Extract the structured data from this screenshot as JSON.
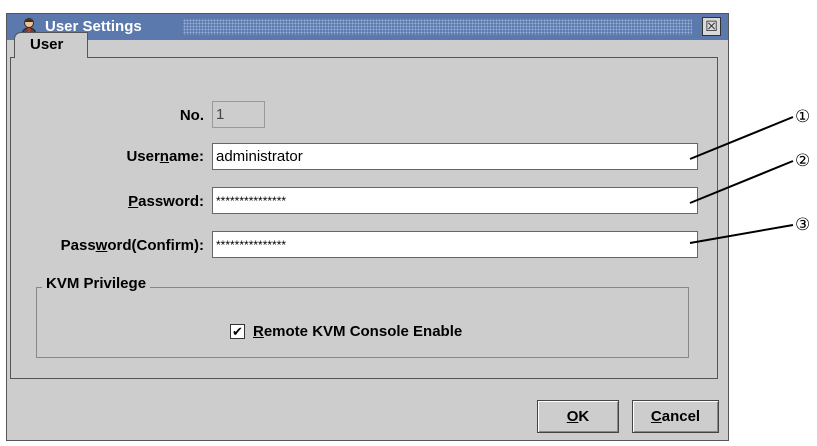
{
  "window": {
    "title": "User Settings",
    "close_label": "☒"
  },
  "tabs": [
    {
      "label": "User"
    }
  ],
  "form": {
    "no": {
      "label": "No.",
      "value": "1"
    },
    "username": {
      "label_pre": "User",
      "label_u": "n",
      "label_post": "ame:",
      "value": "administrator"
    },
    "password": {
      "label_pre": "",
      "label_u": "P",
      "label_post": "assword:",
      "value": "***************"
    },
    "password_confirm": {
      "label_pre": "Pass",
      "label_u": "w",
      "label_post": "ord(Confirm):",
      "value": "***************"
    }
  },
  "kvm": {
    "group_title": "KVM Privilege",
    "checkbox_mark": "✔",
    "checked": true,
    "label_u": "R",
    "label_post": "emote KVM Console Enable"
  },
  "buttons": {
    "ok_u": "O",
    "ok_post": "K",
    "cancel_u": "C",
    "cancel_post": "ancel"
  },
  "callouts": [
    "①",
    "②",
    "③"
  ],
  "colors": {
    "titlebar": "#5b79ad",
    "dialog_bg": "#cdcdcd"
  }
}
